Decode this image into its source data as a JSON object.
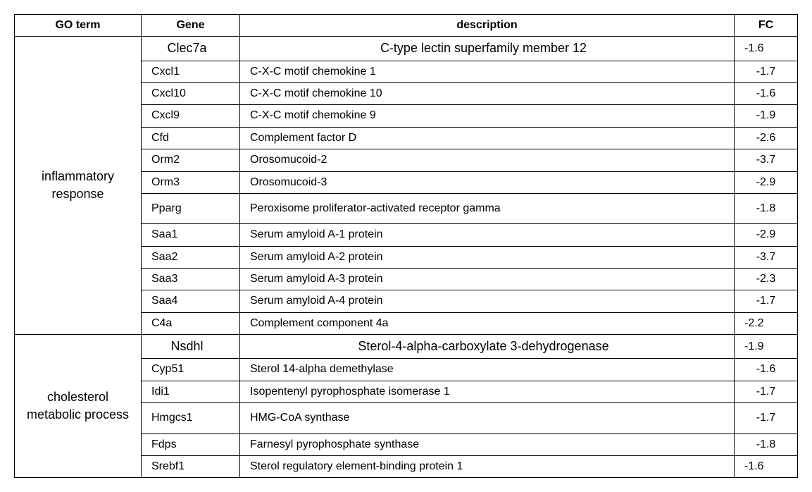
{
  "headers": {
    "go": "GO term",
    "gene": "Gene",
    "desc": "description",
    "fc": "FC"
  },
  "groups": [
    {
      "go_term": "inflammatory response",
      "rows": [
        {
          "gene": "Clec7a",
          "desc": "C-type lectin superfamily member 12",
          "fc": "-1.6",
          "head": true,
          "fc_left": true
        },
        {
          "gene": "Cxcl1",
          "desc": "C-X-C motif chemokine  1",
          "fc": "-1.7"
        },
        {
          "gene": "Cxcl10",
          "desc": "C-X-C motif chemokine  10",
          "fc": "-1.6"
        },
        {
          "gene": "Cxcl9",
          "desc": "C-X-C motif chemokine  9",
          "fc": "-1.9"
        },
        {
          "gene": "Cfd",
          "desc": "Complement factor D",
          "fc": "-2.6"
        },
        {
          "gene": "Orm2",
          "desc": "Orosomucoid-2",
          "fc": "-3.7"
        },
        {
          "gene": "Orm3",
          "desc": "Orosomucoid-3",
          "fc": "-2.9"
        },
        {
          "gene": "Pparg",
          "desc": "Peroxisome  proliferator-activated receptor gamma",
          "fc": "-1.8",
          "tall": true
        },
        {
          "gene": "Saa1",
          "desc": "Serum amyloid A-1  protein",
          "fc": "-2.9"
        },
        {
          "gene": "Saa2",
          "desc": "Serum amyloid A-2  protein",
          "fc": "-3.7"
        },
        {
          "gene": "Saa3",
          "desc": "Serum amyloid A-3  protein",
          "fc": "-2.3"
        },
        {
          "gene": "Saa4",
          "desc": "Serum amyloid A-4  protein",
          "fc": "-1.7"
        },
        {
          "gene": "C4a",
          "desc": "Complement component  4a",
          "fc": "-2.2",
          "fc_left": true
        }
      ]
    },
    {
      "go_term": "cholesterol metabolic process",
      "rows": [
        {
          "gene": "Nsdhl",
          "desc": "Sterol-4-alpha-carboxylate  3-dehydrogenase",
          "fc": "-1.9",
          "head": true,
          "fc_left": true
        },
        {
          "gene": "Cyp51",
          "desc": "Sterol 14-alpha  demethylase",
          "fc": "-1.6"
        },
        {
          "gene": "Idi1",
          "desc": "Isopentenyl  pyrophosphate isomerase 1",
          "fc": "-1.7"
        },
        {
          "gene": "Hmgcs1",
          "desc": "HMG-CoA synthase",
          "fc": "-1.7",
          "tall": true
        },
        {
          "gene": "Fdps",
          "desc": "Farnesyl   pyrophosphate synthase",
          "fc": "-1.8"
        },
        {
          "gene": "Srebf1",
          "desc": "Sterol   regulatory element-binding protein 1",
          "fc": "-1.6",
          "fc_left": true
        }
      ]
    }
  ]
}
